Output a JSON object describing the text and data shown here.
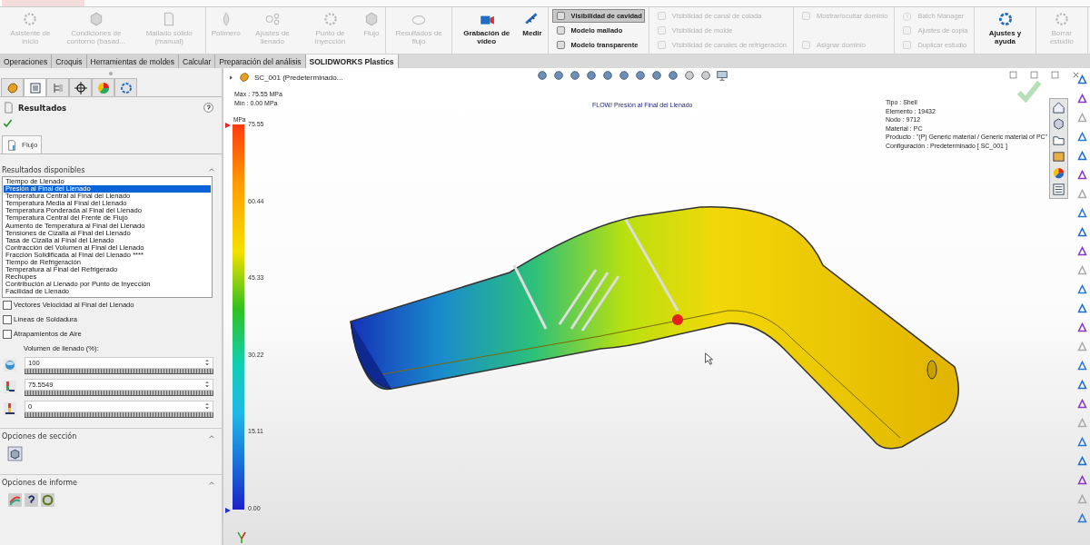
{
  "ribbon": {
    "groups": [
      {
        "kind": "large",
        "buttons": [
          {
            "label": "Asistente de inicio",
            "disabled": true
          },
          {
            "label": "Condiciones de contorno (basad...",
            "disabled": true
          },
          {
            "label": "Mallado sólido (manual)",
            "disabled": true
          }
        ]
      },
      {
        "kind": "large",
        "buttons": [
          {
            "label": "Polímero",
            "disabled": true
          },
          {
            "label": "Ajustes de llenado",
            "disabled": true
          },
          {
            "label": "Punto de inyección",
            "disabled": true
          },
          {
            "label": "Flujo",
            "disabled": true
          }
        ]
      },
      {
        "kind": "large",
        "buttons": [
          {
            "label": "Resultados de flujo",
            "disabled": true
          }
        ]
      },
      {
        "kind": "large",
        "buttons": [
          {
            "label": "Grabación de vídeo",
            "disabled": false
          },
          {
            "label": "Medir",
            "disabled": false
          }
        ]
      },
      {
        "kind": "small",
        "buttons": [
          {
            "label": "Visibilidad de cavidad",
            "disabled": false,
            "on": true
          },
          {
            "label": "Modelo mallado",
            "disabled": false,
            "on": false
          },
          {
            "label": "Modelo transparente",
            "disabled": false,
            "on": false
          }
        ]
      },
      {
        "kind": "small",
        "buttons": [
          {
            "label": "Visibilidad de canal de colada",
            "disabled": true,
            "on": false
          },
          {
            "label": "Visibilidad de molde",
            "disabled": true,
            "on": false
          },
          {
            "label": "Visibilidad de canales de refrigeración",
            "disabled": true,
            "on": false
          }
        ]
      },
      {
        "kind": "small",
        "buttons": [
          {
            "label": "Mostrar/ocultar dominio",
            "disabled": true,
            "on": false
          },
          {
            "label": "Asignar dominio",
            "disabled": true,
            "on": false
          }
        ]
      },
      {
        "kind": "small",
        "buttons": [
          {
            "label": "Batch Manager",
            "disabled": true,
            "on": false
          },
          {
            "label": "Ajustes de copia",
            "disabled": true,
            "on": false
          },
          {
            "label": "Duplicar estudio",
            "disabled": true,
            "on": false
          }
        ]
      },
      {
        "kind": "large",
        "buttons": [
          {
            "label": "Ajustes y ayuda",
            "disabled": false
          }
        ]
      },
      {
        "kind": "large",
        "buttons": [
          {
            "label": "Borrar estudio",
            "disabled": true
          }
        ]
      }
    ]
  },
  "command_tabs": [
    {
      "label": "Operaciones",
      "selected": false
    },
    {
      "label": "Croquis",
      "selected": false
    },
    {
      "label": "Herramientas de moldes",
      "selected": false
    },
    {
      "label": "Calcular",
      "selected": false
    },
    {
      "label": "Preparación del análisis",
      "selected": false
    },
    {
      "label": "SOLIDWORKS Plastics",
      "selected": true
    }
  ],
  "panel": {
    "tabs": [
      {
        "selected": false
      },
      {
        "selected": true
      },
      {
        "selected": false
      },
      {
        "selected": false
      },
      {
        "selected": false
      },
      {
        "selected": false
      }
    ],
    "title": "Resultados",
    "subtab": "Flujo",
    "results_heading": "Resultados disponibles",
    "results": [
      {
        "label": "Tiempo de Llenado",
        "selected": false
      },
      {
        "label": "Presión al Final del Llenado",
        "selected": true
      },
      {
        "label": "Temperatura Central al Final del Llenado",
        "selected": false
      },
      {
        "label": "Temperatura Media al Final del Llenado",
        "selected": false
      },
      {
        "label": "Temperatura Ponderada al Final del Llenado",
        "selected": false
      },
      {
        "label": "Temperatura Central del Frente de Flujo",
        "selected": false
      },
      {
        "label": "Aumento de Temperatura al Final del Llenado",
        "selected": false
      },
      {
        "label": "Tensiones de Cizalla al Final del Llenado",
        "selected": false
      },
      {
        "label": "Tasa de Cizalla al Final del Llenado",
        "selected": false
      },
      {
        "label": "Contracción del Volumen al Final del Llenado",
        "selected": false
      },
      {
        "label": "Fracción Solidificada al Final del Llenado ****",
        "selected": false
      },
      {
        "label": "Tiempo de Refrigeración",
        "selected": false
      },
      {
        "label": "Temperatura al Final del Refrigerado",
        "selected": false
      },
      {
        "label": "Rechupes",
        "selected": false
      },
      {
        "label": "Contribución al Llenado por Punto de Inyección",
        "selected": false
      },
      {
        "label": "Facilidad de Llenado",
        "selected": false
      }
    ],
    "checkboxes": [
      {
        "label": "Vectores Velocidad al Final del Llenado",
        "checked": false
      },
      {
        "label": "Líneas de Soldadura",
        "checked": false
      },
      {
        "label": "Atrapamientos de Aire",
        "checked": false
      }
    ],
    "fill_label": "Volumen de llenado (%):",
    "fields": [
      {
        "value": "100"
      },
      {
        "value": "75.5549"
      },
      {
        "value": "0"
      }
    ],
    "sections": [
      {
        "title": "Opciones de sección"
      },
      {
        "title": "Opciones de informe"
      }
    ]
  },
  "viewport": {
    "tree_item": "SC_001  (Predeterminado...",
    "max": "Máx : 75.55 MPa",
    "min": "Mín : 0.00 MPa",
    "plot_title": "FLOW/ Presión al Final del Llenado",
    "info": [
      "Tipo : Shell",
      "Elemento : 19432",
      "Nodo : 9712",
      "Material : PC",
      "Producto :   \"(P)  Generic material / Generic material of PC\"",
      "Configuración : Predeterminado [ SC_001 ]"
    ],
    "legend": {
      "unit": "MPa",
      "ticks": [
        "75.55",
        "60.44",
        "45.33",
        "30.22",
        "15.11",
        "0.00"
      ]
    }
  }
}
